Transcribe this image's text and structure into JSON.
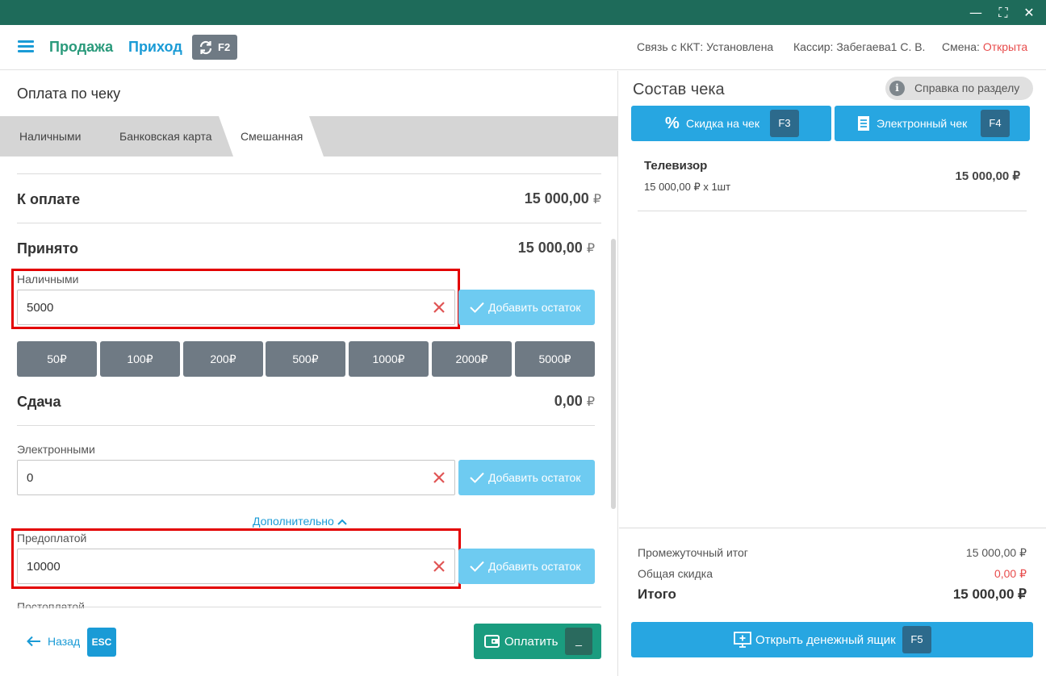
{
  "window": {
    "minimize": "—",
    "maximize": "⛶",
    "close": "✕"
  },
  "header": {
    "nav_sale": "Продажа",
    "nav_income": "Приход",
    "sync_key": "F2",
    "kkt_label": "Связь с ККТ:",
    "kkt_value": "Установлена",
    "cashier_label": "Кассир:",
    "cashier_value": "Забегаева1 С. В.",
    "shift_label": "Смена:",
    "shift_value": "Открыта",
    "shift_color": "#e84c4c"
  },
  "payment": {
    "title": "Оплата по чеку",
    "tabs": [
      "Наличными",
      "Банковская карта",
      "Смешанная"
    ],
    "active_tab": "Смешанная",
    "to_pay_label": "К оплате",
    "to_pay_value": "15 000,00",
    "accepted_label": "Принято",
    "accepted_value": "15 000,00",
    "currency": "₽",
    "cash_label": "Наличными",
    "cash_value": "5000",
    "add_remainder": "Добавить остаток",
    "quick_amounts": [
      "50₽",
      "100₽",
      "200₽",
      "500₽",
      "1000₽",
      "2000₽",
      "5000₽"
    ],
    "change_label": "Сдача",
    "change_value": "0,00",
    "electronic_label": "Электронными",
    "electronic_value": "0",
    "more_label": "Дополнительно",
    "prepay_label": "Предоплатой",
    "prepay_value": "10000",
    "postpay_label": "Постоплатой",
    "back_label": "Назад",
    "back_key": "ESC",
    "pay_label": "Оплатить",
    "pay_key": "_"
  },
  "receipt": {
    "title": "Состав чека",
    "help_label": "Справка по разделу",
    "discount_label": "Скидка на чек",
    "discount_key": "F3",
    "e_receipt_label": "Электронный чек",
    "e_receipt_key": "F4",
    "item": {
      "name": "Телевизор",
      "details": "15 000,00 ₽ x 1шт",
      "price": "15 000,00 ₽"
    },
    "subtotal_label": "Промежуточный итог",
    "subtotal_value": "15 000,00 ₽",
    "discount_total_label": "Общая скидка",
    "discount_total_value": "0,00 ₽",
    "discount_color": "#e84c4c",
    "total_label": "Итого",
    "total_value": "15 000,00 ₽",
    "cash_drawer_label": "Открыть денежный ящик",
    "cash_drawer_key": "F5"
  },
  "colors": {
    "titlebar": "#1e6b5a",
    "accent_green": "#2a9a7b",
    "accent_blue": "#1a9bd6",
    "highlight_red": "#e30000"
  }
}
